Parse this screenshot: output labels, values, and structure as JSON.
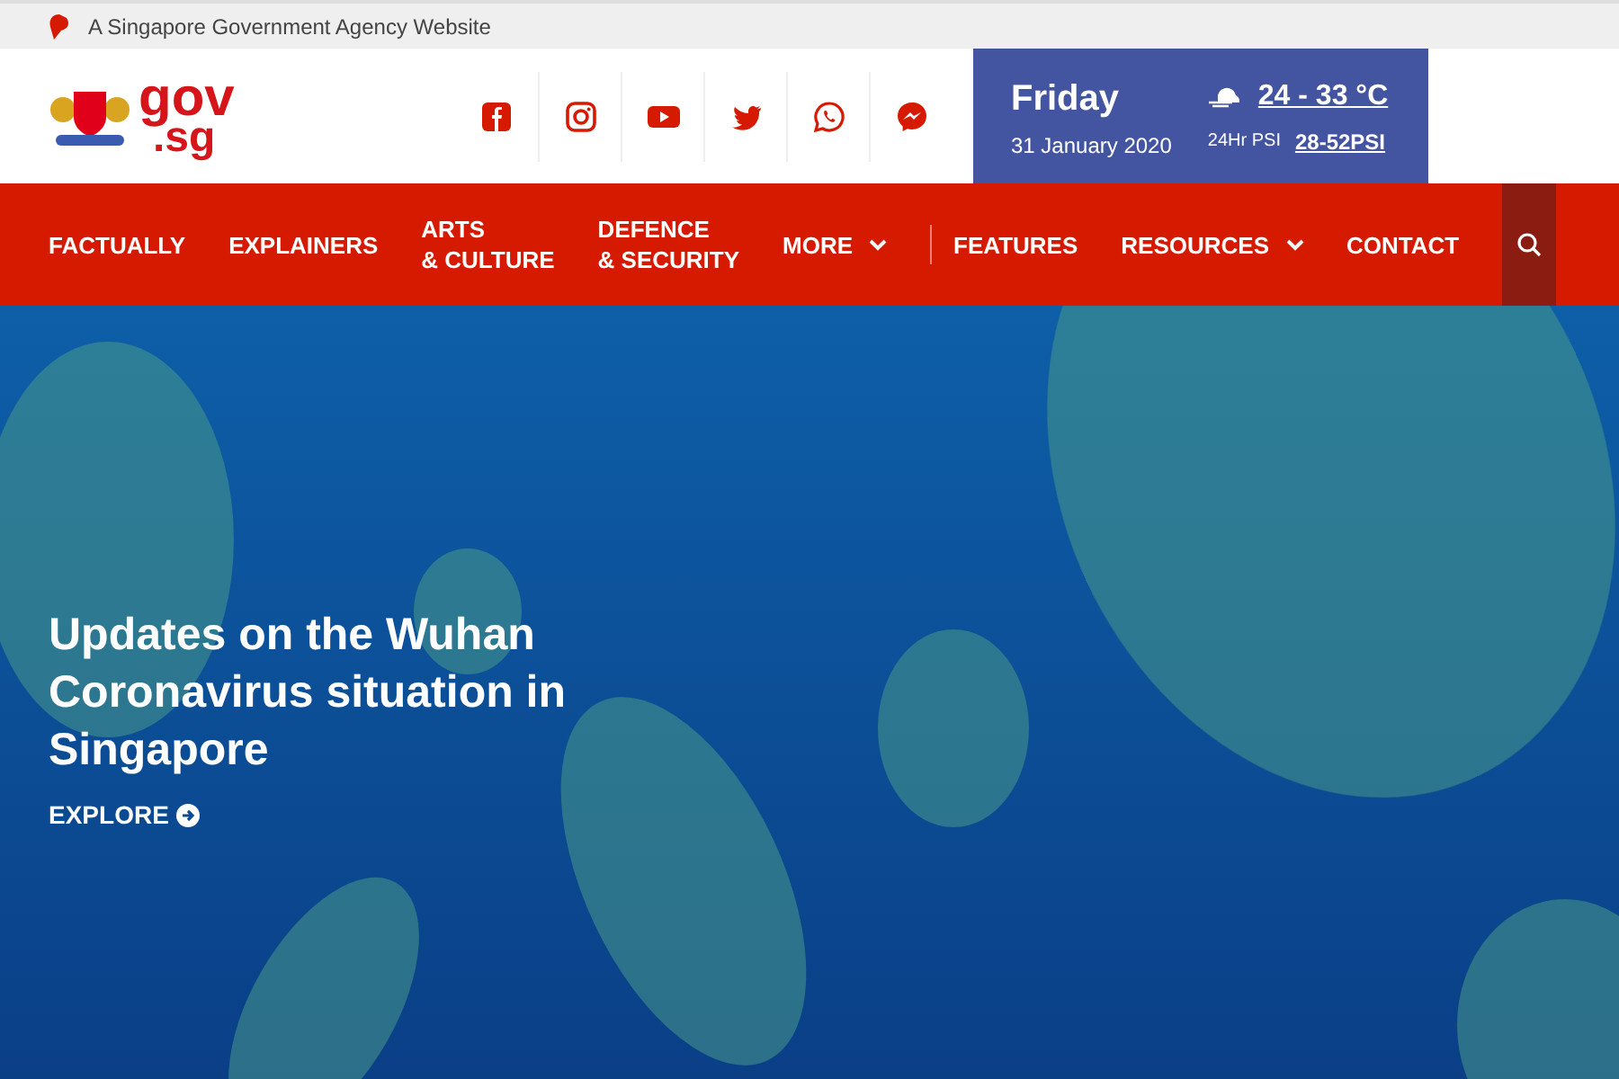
{
  "masthead": {
    "text": "A Singapore Government Agency Website"
  },
  "logo": {
    "line_1": "gov",
    "line_2": ".sg"
  },
  "weather": {
    "day": "Friday",
    "date": "31 January 2020",
    "temperature": "24 - 33 °C",
    "psi_label": "24Hr PSI",
    "psi_value": "28-52PSI"
  },
  "nav": [
    {
      "label": "FACTUALLY",
      "kind": "link"
    },
    {
      "label": "EXPLAINERS",
      "kind": "link"
    },
    {
      "label": "ARTS\n& CULTURE",
      "kind": "link"
    },
    {
      "label": "DEFENCE\n& SECURITY",
      "kind": "link"
    },
    {
      "label": "MORE",
      "kind": "dropdown"
    },
    {
      "label": "FEATURES",
      "kind": "link",
      "divider": true
    },
    {
      "label": "RESOURCES",
      "kind": "dropdown"
    },
    {
      "label": "CONTACT",
      "kind": "link"
    }
  ],
  "hero": {
    "title": "Updates on the Wuhan Coronavirus situation in Singapore",
    "link": "EXPLORE"
  }
}
